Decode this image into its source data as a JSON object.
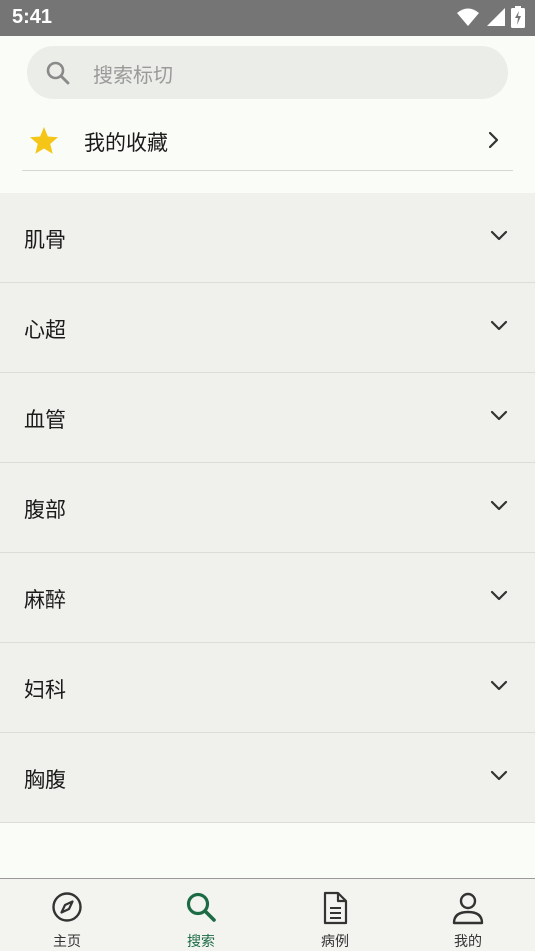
{
  "status_bar": {
    "time": "5:41",
    "icons": [
      "wifi-icon",
      "signal-icon",
      "battery-charging-icon"
    ]
  },
  "search": {
    "placeholder": "搜索标切",
    "icon": "search-icon"
  },
  "favorites": {
    "label": "我的收藏",
    "icon": "star-icon",
    "star_color": "#f5c518"
  },
  "categories": [
    {
      "label": "肌骨"
    },
    {
      "label": "心超"
    },
    {
      "label": "血管"
    },
    {
      "label": "腹部"
    },
    {
      "label": "麻醉"
    },
    {
      "label": "妇科"
    },
    {
      "label": "胸腹"
    }
  ],
  "bottom_nav": {
    "active_color": "#1d6b45",
    "items": [
      {
        "label": "主页",
        "icon": "compass-icon"
      },
      {
        "label": "搜索",
        "icon": "search-icon",
        "active": true
      },
      {
        "label": "病例",
        "icon": "document-icon"
      },
      {
        "label": "我的",
        "icon": "person-icon"
      }
    ]
  }
}
